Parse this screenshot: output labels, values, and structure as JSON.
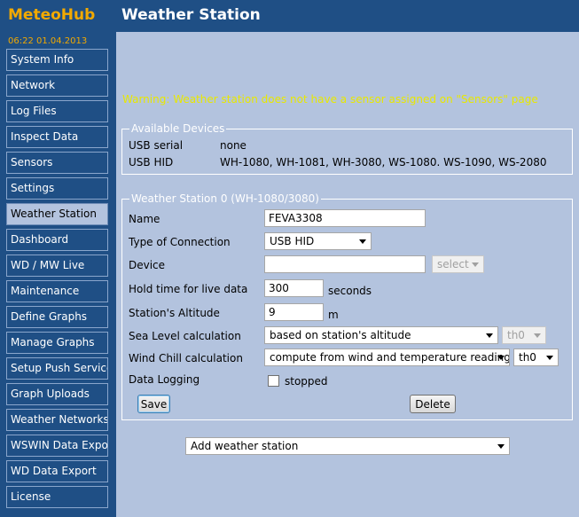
{
  "app": {
    "logo": "MeteoHub",
    "page_title": "Weather Station",
    "clock": "06:22   01.04.2013"
  },
  "sidebar": {
    "items": [
      {
        "label": "System Info"
      },
      {
        "label": "Network"
      },
      {
        "label": "Log Files"
      },
      {
        "label": "Inspect Data"
      },
      {
        "label": "Sensors"
      },
      {
        "label": "Settings"
      },
      {
        "label": "Weather Station"
      },
      {
        "label": "Dashboard"
      },
      {
        "label": "WD / MW Live"
      },
      {
        "label": "Maintenance"
      },
      {
        "label": "Define Graphs"
      },
      {
        "label": "Manage Graphs"
      },
      {
        "label": "Setup Push Services"
      },
      {
        "label": "Graph Uploads"
      },
      {
        "label": "Weather Networks"
      },
      {
        "label": "WSWIN Data Export"
      },
      {
        "label": "WD Data Export"
      },
      {
        "label": "License"
      }
    ],
    "active_index": 6
  },
  "warning": "Warning: Weather station does not have a sensor assigned on \"Sensors\" page",
  "available_devices": {
    "legend": "Available Devices",
    "rows": [
      {
        "label": "USB serial",
        "value": "none"
      },
      {
        "label": "USB HID",
        "value": "WH-1080, WH-1081, WH-3080, WS-1080. WS-1090, WS-2080"
      }
    ]
  },
  "station": {
    "legend": "Weather Station 0 (WH-1080/3080)",
    "name": {
      "label": "Name",
      "value": "FEVA3308"
    },
    "connection": {
      "label": "Type of Connection",
      "value": "USB HID"
    },
    "device": {
      "label": "Device",
      "value": "",
      "select": "select"
    },
    "hold_time": {
      "label": "Hold time for live data",
      "value": "300",
      "unit": "seconds"
    },
    "altitude": {
      "label": "Station's Altitude",
      "value": "9",
      "unit": "m"
    },
    "sea_level": {
      "label": "Sea Level calculation",
      "value": "based on station's altitude",
      "sensor": "th0"
    },
    "wind_chill": {
      "label": "Wind Chill calculation",
      "value": "compute from wind and temperature readings",
      "sensor": "th0"
    },
    "logging": {
      "label": "Data Logging",
      "status": "stopped",
      "checked": false
    },
    "save_label": "Save",
    "delete_label": "Delete"
  },
  "add_station": "Add weather station"
}
